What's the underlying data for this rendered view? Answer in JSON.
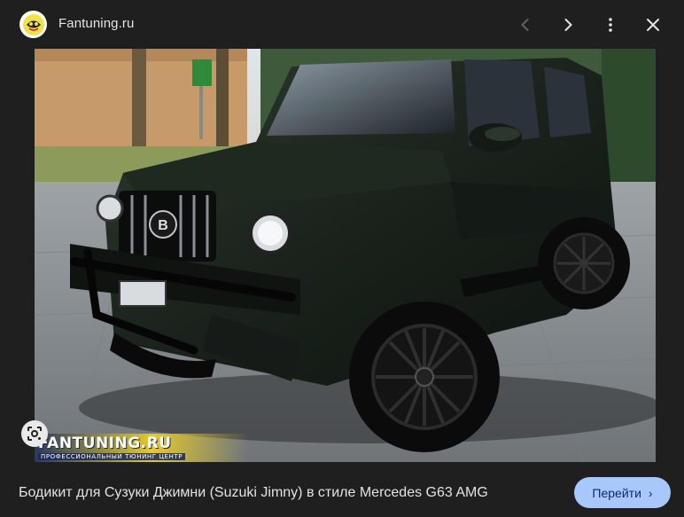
{
  "header": {
    "site_name": "Fantuning.ru",
    "favicon": "fantuning-logo",
    "controls": [
      "previous-icon",
      "next-icon",
      "more-options-icon",
      "close-icon"
    ]
  },
  "image": {
    "alt": "Бодикит для Сузуки Джимни (Suzuki Jimny) в стиле Mercedes G63 AMG",
    "watermark_title": "FANTUNING.RU",
    "watermark_subtitle": "ПРОФЕССИОНАЛЬНЫЙ ТЮНИНГ ЦЕНТР",
    "grille_badge": "B"
  },
  "lens_button": {
    "icon": "google-lens-icon"
  },
  "footer": {
    "caption": "Бодикит для Сузуки Джимни (Suzuki Jimny) в стиле Mercedes G63 AMG",
    "visit_label": "Перейти",
    "visit_chevron": "›"
  },
  "colors": {
    "background": "#1f1f1f",
    "text": "#e3e3e3",
    "button_bg": "#a8c7fa",
    "button_text": "#062e6f"
  }
}
